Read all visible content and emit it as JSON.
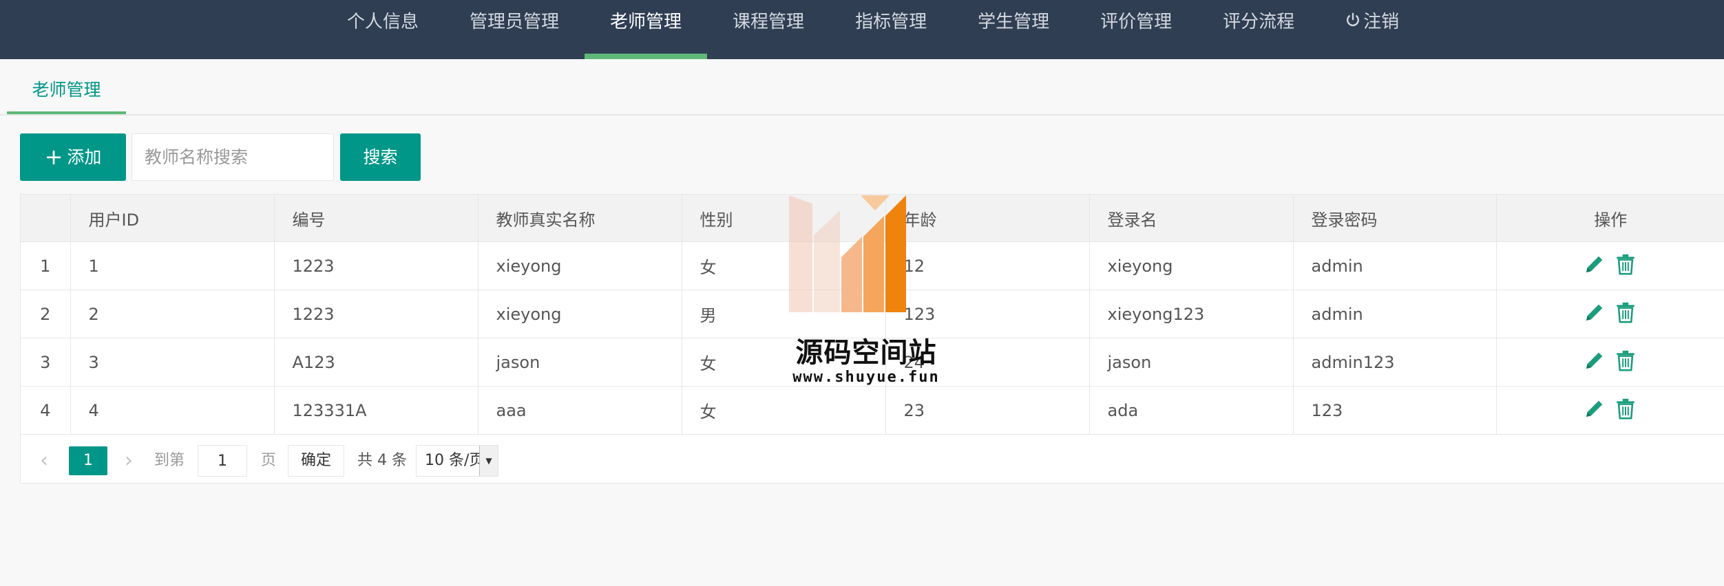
{
  "nav": {
    "items": [
      {
        "label": "个人信息"
      },
      {
        "label": "管理员管理"
      },
      {
        "label": "老师管理"
      },
      {
        "label": "课程管理"
      },
      {
        "label": "指标管理"
      },
      {
        "label": "学生管理"
      },
      {
        "label": "评价管理"
      },
      {
        "label": "评分流程"
      },
      {
        "label": "注销"
      }
    ],
    "active_index": 2
  },
  "tab": {
    "label": "老师管理"
  },
  "toolbar": {
    "add_label": "添加",
    "search_placeholder": "教师名称搜索",
    "search_label": "搜索"
  },
  "table": {
    "headers": [
      "",
      "用户ID",
      "编号",
      "教师真实名称",
      "性别",
      "年龄",
      "登录名",
      "登录密码",
      "操作"
    ],
    "rows": [
      {
        "idx": "1",
        "id": "1",
        "code": "1223",
        "name": "xieyong",
        "gender": "女",
        "age": "12",
        "login": "xieyong",
        "password": "admin"
      },
      {
        "idx": "2",
        "id": "2",
        "code": "1223",
        "name": "xieyong",
        "gender": "男",
        "age": "123",
        "login": "xieyong123",
        "password": "admin"
      },
      {
        "idx": "3",
        "id": "3",
        "code": "A123",
        "name": "jason",
        "gender": "女",
        "age": "24",
        "login": "jason",
        "password": "admin123"
      },
      {
        "idx": "4",
        "id": "4",
        "code": "123331A",
        "name": "aaa",
        "gender": "女",
        "age": "23",
        "login": "ada",
        "password": "123"
      }
    ]
  },
  "pager": {
    "prev": "‹",
    "current": "1",
    "next": "›",
    "goto_label": "到第",
    "goto_value": "1",
    "page_label": "页",
    "confirm_label": "确定",
    "total_label": "共 4 条",
    "per_page": "10 条/页"
  },
  "watermark": {
    "title": "源码空间站",
    "url": "www.shuyue.fun"
  },
  "colors": {
    "navbar": "#2f3e53",
    "accent": "#009688",
    "active_underline": "#5fb878"
  }
}
